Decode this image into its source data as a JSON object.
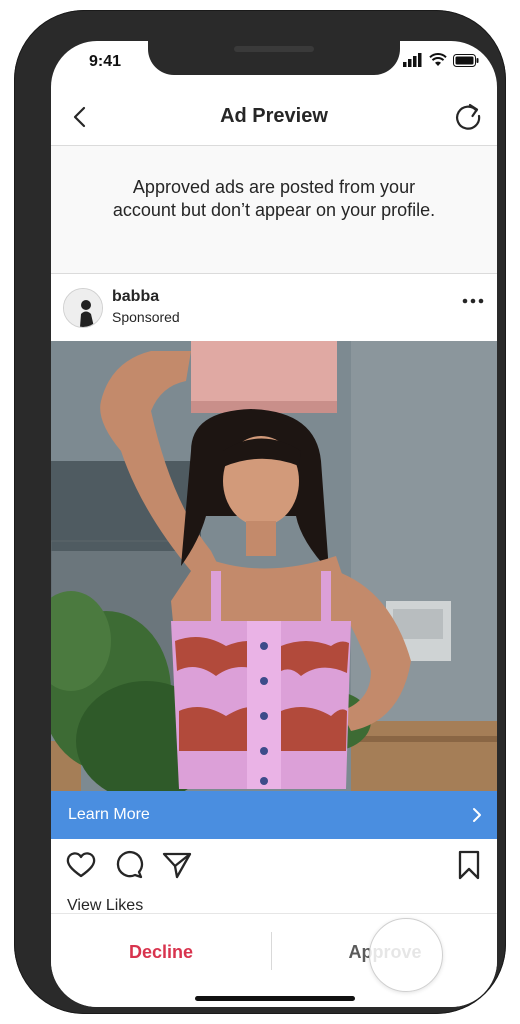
{
  "status_bar": {
    "time": "9:41"
  },
  "nav": {
    "title": "Ad Preview"
  },
  "notice": {
    "text": "Approved ads are posted from your account but don’t appear on your profile."
  },
  "post": {
    "username": "babba",
    "subtitle": "Sponsored",
    "cta_label": "Learn More",
    "view_likes": "View Likes"
  },
  "actions": {
    "decline_label": "Decline",
    "approve_label": "Approve"
  },
  "colors": {
    "cta": "#4a8ee0",
    "decline": "#d8344e",
    "approve": "#5a5a5a"
  },
  "icons": [
    "back-arrow-icon",
    "refresh-icon",
    "cellular-signal-icon",
    "wifi-icon",
    "battery-icon",
    "more-options-icon",
    "chevron-right-icon",
    "heart-icon",
    "comment-icon",
    "share-icon",
    "bookmark-icon"
  ]
}
